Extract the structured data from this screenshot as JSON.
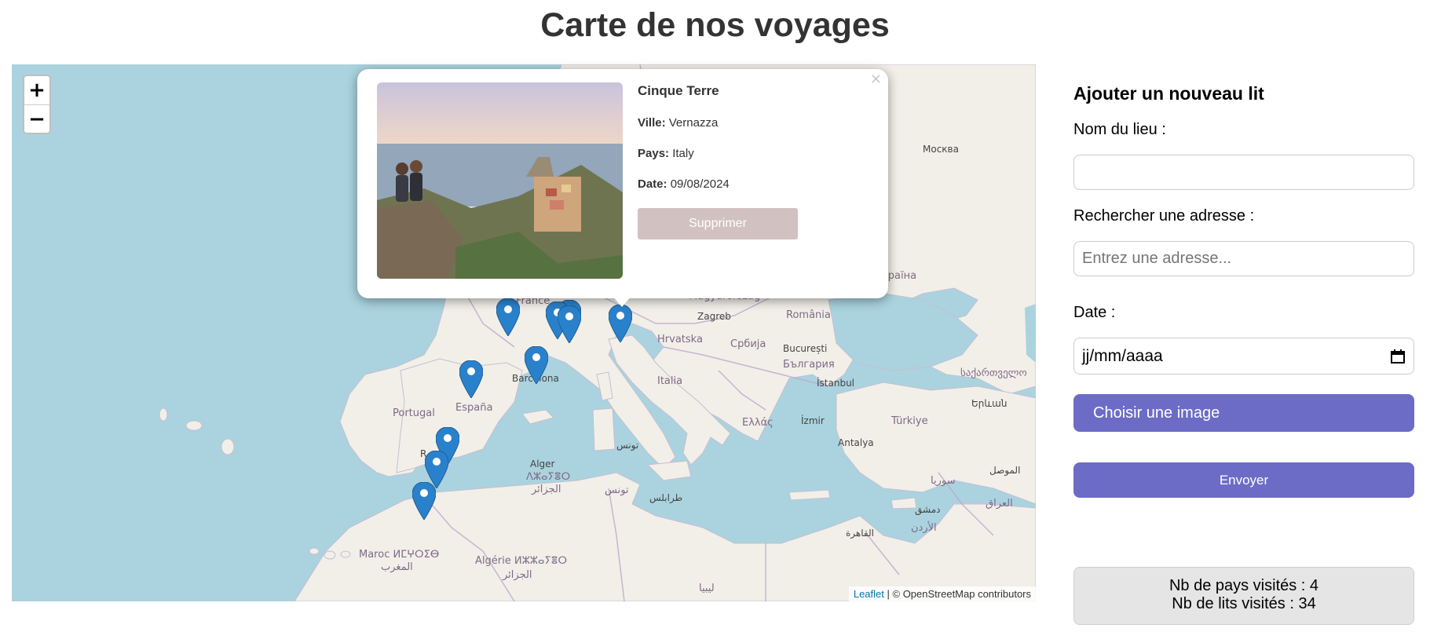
{
  "page": {
    "title": "Carte de nos voyages"
  },
  "map": {
    "zoom_in": "+",
    "zoom_out": "−",
    "attribution": {
      "leaflet": "Leaflet",
      "separator": " | ",
      "osm": "© OpenStreetMap contributors"
    },
    "labels": {
      "moskva": "Москва",
      "france": "France",
      "zagreb": "Zagreb",
      "romania": "România",
      "magyarorszag": "Magyarország",
      "hrvatska": "Hrvatska",
      "srbija": "Србија",
      "bucuresti": "București",
      "bulgaria": "България",
      "barcelona": "Barcelona",
      "portugal": "Portugal",
      "espana": "España",
      "italia": "Italia",
      "istanbul": "İstanbul",
      "ellas": "Ελλάς",
      "izmir": "İzmir",
      "turkiye": "Türkiye",
      "antalya": "Antalya",
      "sakartvelo": "საქართველო",
      "yerevan": "Երևան",
      "tunis_ar": "تونس",
      "tunis": "تونس",
      "alger": "Alger",
      "alger_tif": "ⴷⵣⴰⵢⴻⵔ",
      "alger_ar": "الجزائر",
      "tarabulus": "طرابلس",
      "maroc": "Maroc ⵍⵎⵖⵔⵉⴱ",
      "maroc_ar": "المغرب",
      "algerie": "Algérie ⵍⵣⵣⴰⵢⴻⵔ",
      "algerie_ar": "الجزائر",
      "libya": "ليبيا",
      "qahira": "القاهرة",
      "suriya": "سوريا",
      "dimashq": "دمشق",
      "urdun": "الأردن",
      "iraq": "العراق",
      "mawsil": "الموصل",
      "ukraina": "Україна",
      "rabat": "R"
    }
  },
  "popup": {
    "close": "×",
    "title": "Cinque Terre",
    "ville_label": "Ville:",
    "ville": "Vernazza",
    "pays_label": "Pays:",
    "pays": "Italy",
    "date_label": "Date:",
    "date": "09/08/2024",
    "delete_label": "Supprimer"
  },
  "form": {
    "title": "Ajouter un nouveau lit",
    "name_label": "Nom du lieu :",
    "name_value": "",
    "address_label": "Rechercher une adresse :",
    "address_placeholder": "Entrez une adresse...",
    "date_label": "Date :",
    "date_placeholder": "jj/mm/aaaa",
    "choose_image_label": "Choisir une image",
    "submit_label": "Envoyer"
  },
  "stats": {
    "countries": "Nb de pays visités : 4",
    "beds": "Nb de lits visités : 34"
  },
  "colors": {
    "accent": "#6c6cc6",
    "delete": "#d2c1c1",
    "sea": "#aad3df",
    "land": "#f2efe9",
    "marker": "#2a81cb"
  }
}
